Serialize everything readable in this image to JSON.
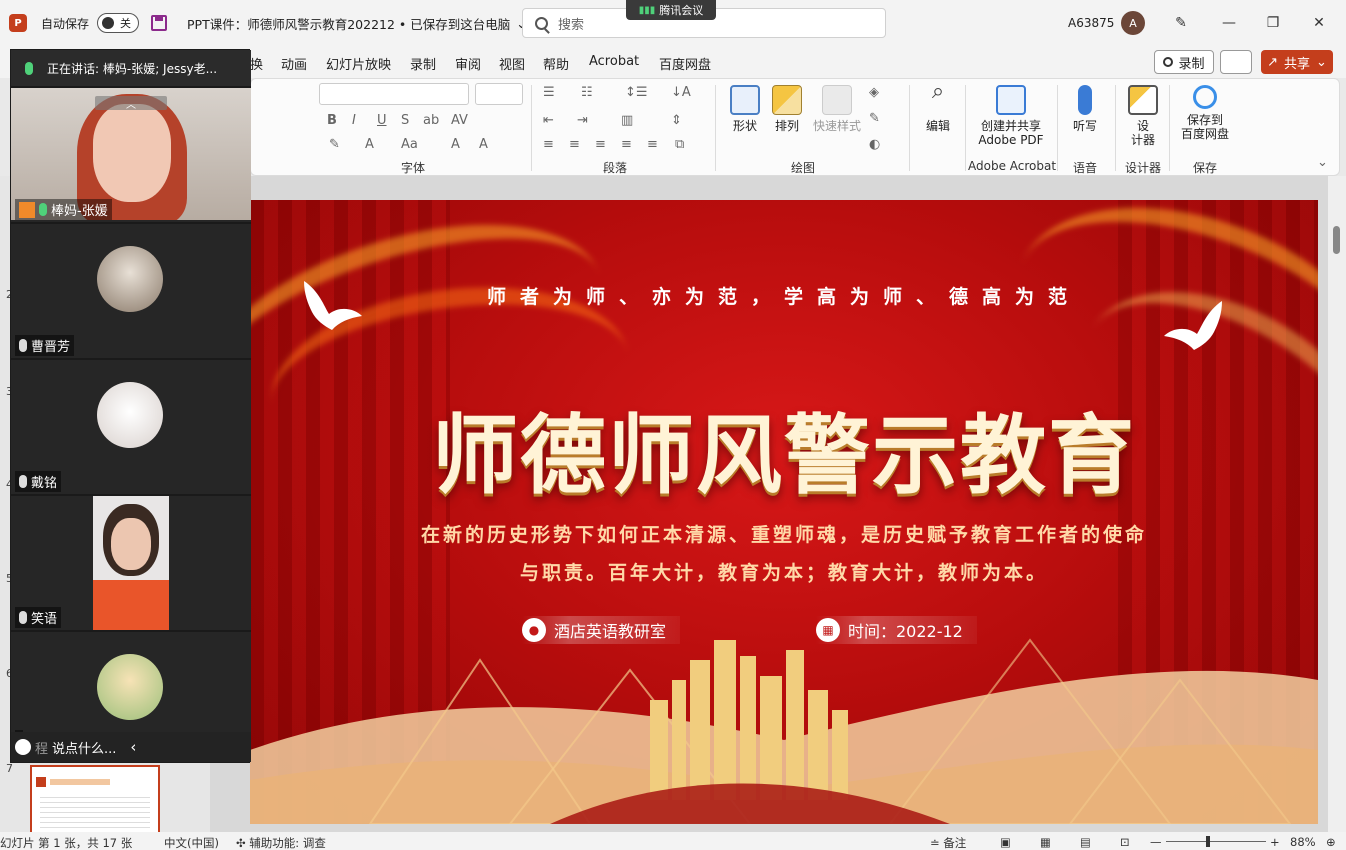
{
  "titlebar": {
    "app_icon": "P",
    "autosave_label": "自动保存",
    "autosave_state": "关",
    "doc_title": "PPT课件：师德师风警示教育202212 • 已保存到这台电脑",
    "search_placeholder": "搜索",
    "meeting_app": "腾讯会议",
    "user_name": "A63875",
    "avatar_initial": "A"
  },
  "ribbon": {
    "tabs": [
      "换",
      "动画",
      "幻灯片放映",
      "录制",
      "审阅",
      "视图",
      "帮助",
      "Acrobat",
      "百度网盘"
    ],
    "record_label": "录制",
    "share_label": "共享",
    "groups": {
      "font": "字体",
      "paragraph": "段落",
      "drawing": "绘图",
      "acrobat": "Adobe Acrobat",
      "voice": "语音",
      "designer": "设计器",
      "save": "保存"
    },
    "buttons": {
      "shape": "形状",
      "arrange": "排列",
      "quick_style": "快速样式",
      "edit": "编辑",
      "create_share_pdf_1": "创建并共享",
      "create_share_pdf_2": "Adobe PDF",
      "dictate": "听写",
      "designer_1": "设",
      "designer_2": "计器",
      "save_baidu_1": "保存到",
      "save_baidu_2": "百度网盘"
    }
  },
  "thumbnails": {
    "numbers": [
      "2",
      "3",
      "4",
      "5",
      "6",
      "7"
    ]
  },
  "slide": {
    "motto": "师者为师、亦为范，学高为师、德高为范",
    "title": "师德师风警示教育",
    "subtitle_line1": "在新的历史形势下如何正本清源、重塑师魂，是历史赋予教育工作者的使命",
    "subtitle_line2": "与职责。百年大计，教育为本；教育大计，教师为本。",
    "department": "酒店英语教研室",
    "time": "时间：2022-12",
    "colors": {
      "background": "#b80d0d",
      "title": "#fff3d6",
      "gold": "#e8b860"
    }
  },
  "meeting": {
    "speaking": "正在讲话: 棒妈-张媛; Jessy老...",
    "participants": [
      {
        "name": "棒妈-张媛",
        "mic": "on"
      },
      {
        "name": "曹晋芳",
        "mic": "off"
      },
      {
        "name": "戴铭",
        "mic": "off"
      },
      {
        "name": "笑语",
        "mic": "off"
      },
      {
        "name": "",
        "mic": "off"
      }
    ],
    "chat_placeholder": "说点什么...",
    "behind_text": "程"
  },
  "statusbar": {
    "slide_info": "幻灯片 第 1 张，共 17 张",
    "language": "中文(中国)",
    "accessibility": "辅助功能: 调查",
    "notes": "备注",
    "zoom": "88%"
  }
}
